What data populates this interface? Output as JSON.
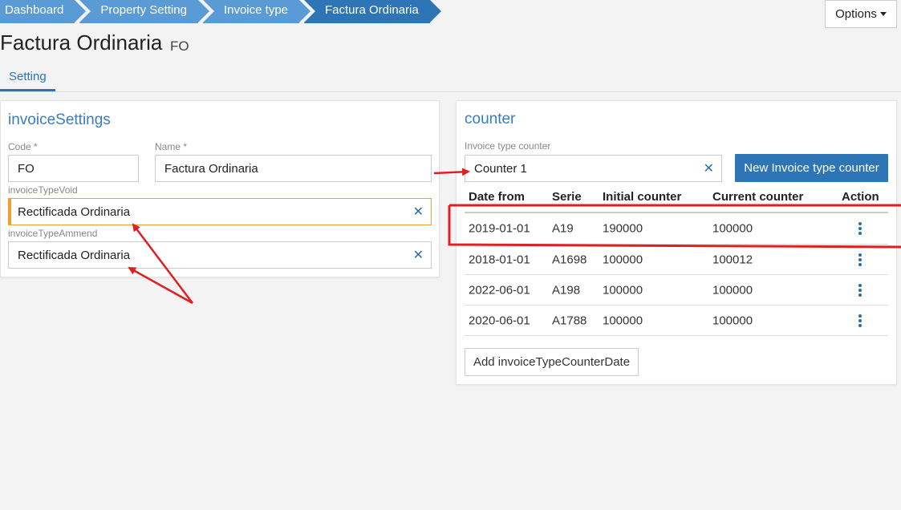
{
  "breadcrumb": [
    "Dashboard",
    "Property Setting",
    "Invoice type",
    "Factura Ordinaria"
  ],
  "options_label": "Options",
  "page": {
    "title": "Factura Ordinaria",
    "code": "FO"
  },
  "tabs": [
    "Setting"
  ],
  "invoice_settings": {
    "title": "invoiceSettings",
    "code_label": "Code *",
    "code_value": "FO",
    "name_label": "Name *",
    "name_value": "Factura Ordinaria",
    "void_label": "invoiceTypeVoid",
    "void_value": "Rectificada Ordinaria",
    "ammend_label": "invoiceTypeAmmend",
    "ammend_value": "Rectificada Ordinaria"
  },
  "counter": {
    "title": "counter",
    "counter_label": "Invoice type counter",
    "counter_value": "Counter 1",
    "new_button": "New Invoice type counter",
    "add_button": "Add invoiceTypeCounterDate",
    "headers": [
      "Date from",
      "Serie",
      "Initial counter",
      "Current counter",
      "Action"
    ],
    "rows": [
      [
        "2019-01-01",
        "A19",
        "190000",
        "100000"
      ],
      [
        "2018-01-01",
        "A1698",
        "100000",
        "100012"
      ],
      [
        "2022-06-01",
        "A198",
        "100000",
        "100000"
      ],
      [
        "2020-06-01",
        "A1788",
        "100000",
        "100000"
      ]
    ]
  },
  "icons": {
    "clear": "close-icon",
    "action": "kebab-menu-icon",
    "dropdown": "caret-down-icon"
  },
  "colors": {
    "primary": "#2e75b6",
    "breadcrumb": "#5b9bd5",
    "highlight": "#f0a030",
    "annotation": "#e02020"
  }
}
